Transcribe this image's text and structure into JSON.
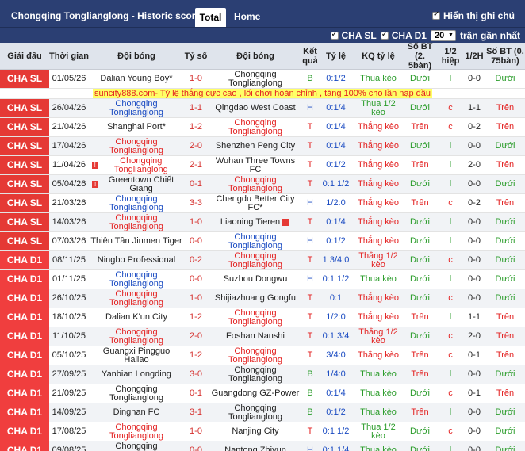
{
  "header": {
    "title": "Chongqing Tonglianglong - Historic scores",
    "tab_total": "Total",
    "tab_home": "Home",
    "notes_label": "Hiển thị ghi chú"
  },
  "filters": {
    "cha_sl": "CHA SL",
    "cha_d1": "CHA D1",
    "count": "20",
    "recent_label": "trận gần nhất"
  },
  "columns": {
    "league": "Giải đấu",
    "date": "Thời gian",
    "home": "Đội bóng",
    "score": "Tỷ số",
    "away": "Đội bóng",
    "result": "Kết quả",
    "odds": "Tỷ lệ",
    "kq_odds": "KQ tỷ lệ",
    "goals": "Số BT (2. 5bàn)",
    "half": "1/2 hiệp",
    "half_score": "1/2H",
    "goals2": "Số BT (0. 75bàn)"
  },
  "ad_text": "suncity888.com- Tỷ lệ thắng cực cao , lối chơi hoàn chỉnh , tăng 100% cho lần nạp đầu",
  "matches": [
    {
      "league": "CHA SL",
      "date": "01/05/26",
      "home": "Dalian Young Boy*",
      "home_style": "plain",
      "score": "1-0",
      "away": "Chongqing Tonglianglong",
      "away_style": "green",
      "res": "B",
      "odds": "0:1/2",
      "kq": "Thua kèo",
      "goal": "Dưới",
      "half": "l",
      "hs": "0-0",
      "goal2": "Dưới"
    },
    {
      "league": "CHA SL",
      "date": "26/04/26",
      "home": "Chongqing Tonglianglong",
      "home_style": "blue",
      "score": "1-1",
      "away": "Qingdao West Coast",
      "away_style": "plain",
      "res": "H",
      "odds": "0:1/4",
      "kq": "Thua 1/2 kèo",
      "goal": "Dưới",
      "half": "c",
      "hs": "1-1",
      "goal2": "Trên"
    },
    {
      "league": "CHA SL",
      "date": "21/04/26",
      "home": "Shanghai Port*",
      "home_style": "plain",
      "score": "1-2",
      "away": "Chongqing Tonglianglong",
      "away_style": "red",
      "res": "T",
      "odds": "0:1/4",
      "kq": "Thắng kèo",
      "goal": "Trên",
      "half": "c",
      "hs": "0-2",
      "goal2": "Trên"
    },
    {
      "league": "CHA SL",
      "date": "17/04/26",
      "home": "Chongqing Tonglianglong",
      "home_style": "red",
      "score": "2-0",
      "away": "Shenzhen Peng City",
      "away_style": "plain",
      "res": "T",
      "odds": "0:1/4",
      "kq": "Thắng kèo",
      "goal": "Dưới",
      "half": "l",
      "hs": "0-0",
      "goal2": "Dưới"
    },
    {
      "league": "CHA SL",
      "date": "11/04/26",
      "home": "Chongqing Tonglianglong",
      "home_style": "red",
      "home_flag": true,
      "score": "2-1",
      "away": "Wuhan Three Towns FC",
      "away_style": "plain",
      "res": "T",
      "odds": "0:1/2",
      "kq": "Thắng kèo",
      "goal": "Trên",
      "half": "l",
      "hs": "2-0",
      "goal2": "Trên"
    },
    {
      "league": "CHA SL",
      "date": "05/04/26",
      "home": "Greentown Chiết Giang",
      "home_style": "plain",
      "home_flag": true,
      "score": "0-1",
      "away": "Chongqing Tonglianglong",
      "away_style": "red",
      "res": "T",
      "odds": "0:1 1/2",
      "kq": "Thắng kèo",
      "goal": "Dưới",
      "half": "l",
      "hs": "0-0",
      "goal2": "Dưới"
    },
    {
      "league": "CHA SL",
      "date": "21/03/26",
      "home": "Chongqing Tonglianglong",
      "home_style": "blue",
      "score": "3-3",
      "away": "Chengdu Better City FC*",
      "away_style": "plain",
      "res": "H",
      "odds": "1/2:0",
      "kq": "Thắng kèo",
      "goal": "Trên",
      "half": "c",
      "hs": "0-2",
      "goal2": "Trên"
    },
    {
      "league": "CHA SL",
      "date": "14/03/26",
      "home": "Chongqing Tonglianglong",
      "home_style": "red",
      "score": "1-0",
      "away": "Liaoning Tieren",
      "away_style": "plain",
      "away_flag": true,
      "res": "T",
      "odds": "0:1/4",
      "kq": "Thắng kèo",
      "goal": "Dưới",
      "half": "l",
      "hs": "0-0",
      "goal2": "Dưới"
    },
    {
      "league": "CHA SL",
      "date": "07/03/26",
      "home": "Thiên Tân Jinmen Tiger",
      "home_style": "plain",
      "score": "0-0",
      "away": "Chongqing Tonglianglong",
      "away_style": "blue",
      "res": "H",
      "odds": "0:1/2",
      "kq": "Thắng kèo",
      "goal": "Dưới",
      "half": "l",
      "hs": "0-0",
      "goal2": "Dưới"
    },
    {
      "league": "CHA D1",
      "date": "08/11/25",
      "home": "Ningbo Professional",
      "home_style": "plain",
      "score": "0-2",
      "away": "Chongqing Tonglianglong",
      "away_style": "red",
      "res": "T",
      "odds": "1 3/4:0",
      "kq": "Thắng 1/2 kèo",
      "goal": "Dưới",
      "half": "c",
      "hs": "0-0",
      "goal2": "Dưới"
    },
    {
      "league": "CHA D1",
      "date": "01/11/25",
      "home": "Chongqing Tonglianglong",
      "home_style": "blue",
      "score": "0-0",
      "away": "Suzhou Dongwu",
      "away_style": "plain",
      "res": "H",
      "odds": "0:1 1/2",
      "kq": "Thua kèo",
      "goal": "Dưới",
      "half": "l",
      "hs": "0-0",
      "goal2": "Dưới"
    },
    {
      "league": "CHA D1",
      "date": "26/10/25",
      "home": "Chongqing Tonglianglong",
      "home_style": "red",
      "score": "1-0",
      "away": "Shijiazhuang Gongfu",
      "away_style": "plain",
      "res": "T",
      "odds": "0:1",
      "kq": "Thắng kèo",
      "goal": "Dưới",
      "half": "c",
      "hs": "0-0",
      "goal2": "Dưới"
    },
    {
      "league": "CHA D1",
      "date": "18/10/25",
      "home": "Dalian K'un City",
      "home_style": "plain",
      "score": "1-2",
      "away": "Chongqing Tonglianglong",
      "away_style": "red",
      "res": "T",
      "odds": "1/2:0",
      "kq": "Thắng kèo",
      "goal": "Trên",
      "half": "l",
      "hs": "1-1",
      "goal2": "Trên"
    },
    {
      "league": "CHA D1",
      "date": "11/10/25",
      "home": "Chongqing Tonglianglong",
      "home_style": "red",
      "score": "2-0",
      "away": "Foshan Nanshi",
      "away_style": "plain",
      "res": "T",
      "odds": "0:1 3/4",
      "kq": "Thắng 1/2 kèo",
      "goal": "Dưới",
      "half": "c",
      "hs": "2-0",
      "goal2": "Trên"
    },
    {
      "league": "CHA D1",
      "date": "05/10/25",
      "home": "Guangxi Pingguo Haliao",
      "home_style": "plain",
      "score": "1-2",
      "away": "Chongqing Tonglianglong",
      "away_style": "red",
      "res": "T",
      "odds": "3/4:0",
      "kq": "Thắng kèo",
      "goal": "Trên",
      "half": "c",
      "hs": "0-1",
      "goal2": "Trên"
    },
    {
      "league": "CHA D1",
      "date": "27/09/25",
      "home": "Yanbian Longding",
      "home_style": "plain",
      "score": "3-0",
      "away": "Chongqing Tonglianglong",
      "away_style": "green",
      "res": "B",
      "odds": "1/4:0",
      "kq": "Thua kèo",
      "goal": "Trên",
      "half": "l",
      "hs": "0-0",
      "goal2": "Dưới"
    },
    {
      "league": "CHA D1",
      "date": "21/09/25",
      "home": "Chongqing Tonglianglong",
      "home_style": "green",
      "score": "0-1",
      "away": "Guangdong GZ-Power",
      "away_style": "plain",
      "res": "B",
      "odds": "0:1/4",
      "kq": "Thua kèo",
      "goal": "Dưới",
      "half": "c",
      "hs": "0-1",
      "goal2": "Trên"
    },
    {
      "league": "CHA D1",
      "date": "14/09/25",
      "home": "Dingnan FC",
      "home_style": "plain",
      "score": "3-1",
      "away": "Chongqing Tonglianglong",
      "away_style": "green",
      "res": "B",
      "odds": "0:1/2",
      "kq": "Thua kèo",
      "goal": "Trên",
      "half": "l",
      "hs": "0-0",
      "goal2": "Dưới"
    },
    {
      "league": "CHA D1",
      "date": "17/08/25",
      "home": "Chongqing Tonglianglong",
      "home_style": "red",
      "score": "1-0",
      "away": "Nanjing City",
      "away_style": "plain",
      "res": "T",
      "odds": "0:1 1/2",
      "kq": "Thua 1/2 kèo",
      "goal": "Dưới",
      "half": "c",
      "hs": "0-0",
      "goal2": "Dưới"
    },
    {
      "league": "CHA D1",
      "date": "09/08/25",
      "home": "Chongqing Tonglianglong",
      "home_style": "green",
      "score": "0-0",
      "away": "Nantong Zhiyun",
      "away_style": "plain",
      "res": "H",
      "odds": "0:1 1/4",
      "kq": "Thua kèo",
      "goal": "Dưới",
      "half": "l",
      "hs": "0-0",
      "goal2": "Dưới"
    }
  ]
}
